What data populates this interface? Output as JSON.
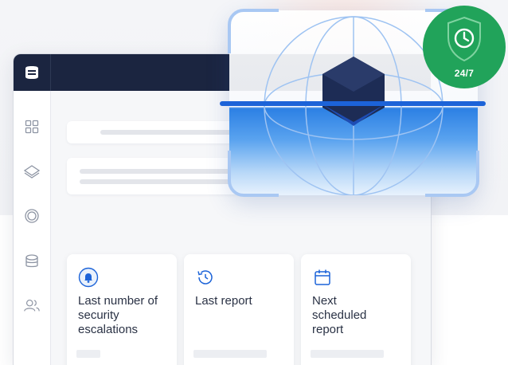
{
  "badge": {
    "text": "24/7",
    "color": "#21a35a",
    "icon": "shield-clock-icon"
  },
  "app": {
    "topbar_color": "#1b2540",
    "logo": "app-logo",
    "sidebar": {
      "items": [
        "dashboard-icon",
        "layers-icon",
        "target-icon",
        "database-icon",
        "users-icon"
      ]
    }
  },
  "cards": [
    {
      "icon": "bell-icon",
      "label": "Last number of\nsecurity\nescalations"
    },
    {
      "icon": "history-icon",
      "label": "Last report"
    },
    {
      "icon": "calendar-icon",
      "label": "Next\nscheduled\nreport"
    }
  ],
  "accent_color": "#1c63d8"
}
